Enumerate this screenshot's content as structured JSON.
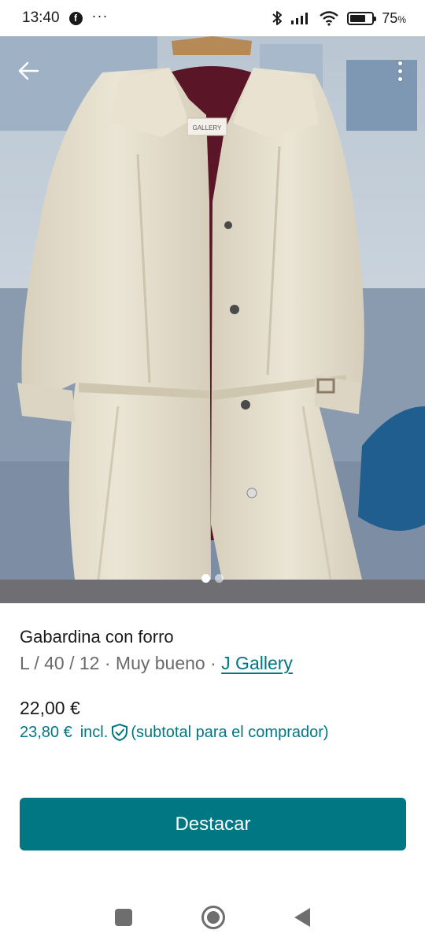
{
  "status_bar": {
    "time": "13:40",
    "facebook_glyph": "f",
    "overflow_dots": "···",
    "battery_percent": "75",
    "battery_percent_unit": "%",
    "battery_level": 0.75,
    "icons": [
      "facebook-icon",
      "bluetooth-icon",
      "signal-icon",
      "wifi-icon",
      "battery-icon"
    ]
  },
  "gallery": {
    "image_count": 2,
    "active_index": 0,
    "label_text": "GALLERY"
  },
  "item": {
    "title": "Gabardina con forro",
    "size": "L / 40 / 12",
    "separator": "·",
    "condition": "Muy bueno",
    "brand": "J Gallery",
    "price": "22,00 €",
    "total_price": "23,80 €",
    "total_incl": "incl.",
    "total_note": "(subtotal para el comprador)"
  },
  "actions": {
    "promote_label": "Destacar"
  },
  "colors": {
    "accent": "#007782",
    "meta_text": "#6b6b6b",
    "coat": "#e4ddcb",
    "lining": "#5a1626"
  }
}
